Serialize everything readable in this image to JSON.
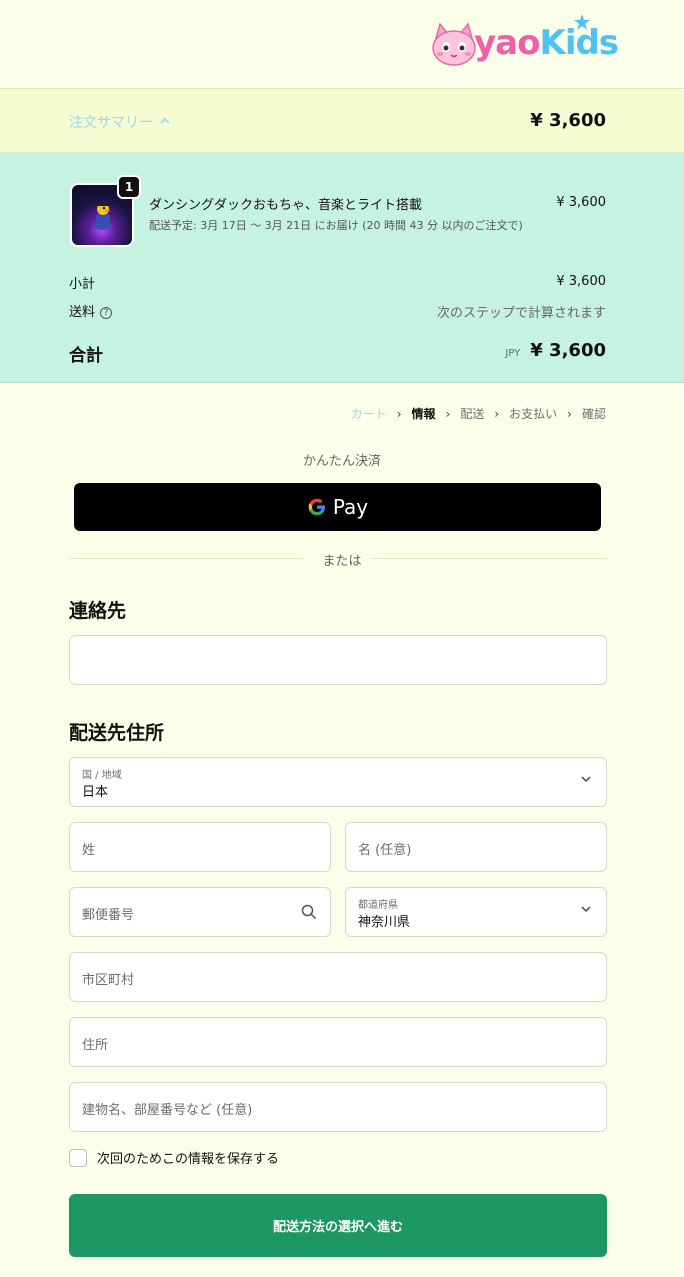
{
  "brand": {
    "logo_text_a": "yao",
    "logo_text_b": "Kids"
  },
  "summary": {
    "toggle_label": "注文サマリー",
    "total": "¥ 3,600"
  },
  "order": {
    "item": {
      "name": "ダンシングダックおもちゃ、音楽とライト搭載",
      "shipping": "配送予定: 3月 17日 〜 3月 21日 にお届け (20 時間 43 分 以内のご注文で)",
      "price": "¥ 3,600",
      "quantity": "1"
    },
    "subtotal_label": "小計",
    "subtotal_value": "¥ 3,600",
    "shipping_label": "送料",
    "shipping_value": "次のステップで計算されます",
    "total_label": "合計",
    "currency": "JPY",
    "total_value": "¥ 3,600"
  },
  "breadcrumb": [
    "カート",
    "情報",
    "配送",
    "お支払い",
    "確認"
  ],
  "express": {
    "label": "かんたん決済",
    "gpay_label": "Pay",
    "or_label": "または"
  },
  "contact": {
    "title": "連絡先",
    "email_placeholder": ""
  },
  "address": {
    "title": "配送先住所",
    "country_label": "国 / 地域",
    "country_value": "日本",
    "last_name_placeholder": "姓",
    "first_name_placeholder": "名 (任意)",
    "postal_placeholder": "郵便番号",
    "prefecture_label": "都道府県",
    "prefecture_value": "神奈川県",
    "city_placeholder": "市区町村",
    "address_placeholder": "住所",
    "building_placeholder": "建物名、部屋番号など (任意)"
  },
  "save_info_label": "次回のためこの情報を保存する",
  "submit_label": "配送方法の選択へ進む",
  "colors": {
    "accent": "#1c9765",
    "order_bg": "#c6f2e1",
    "page_bg": "#fbffe9",
    "summary_bg": "#f5fbd3"
  }
}
